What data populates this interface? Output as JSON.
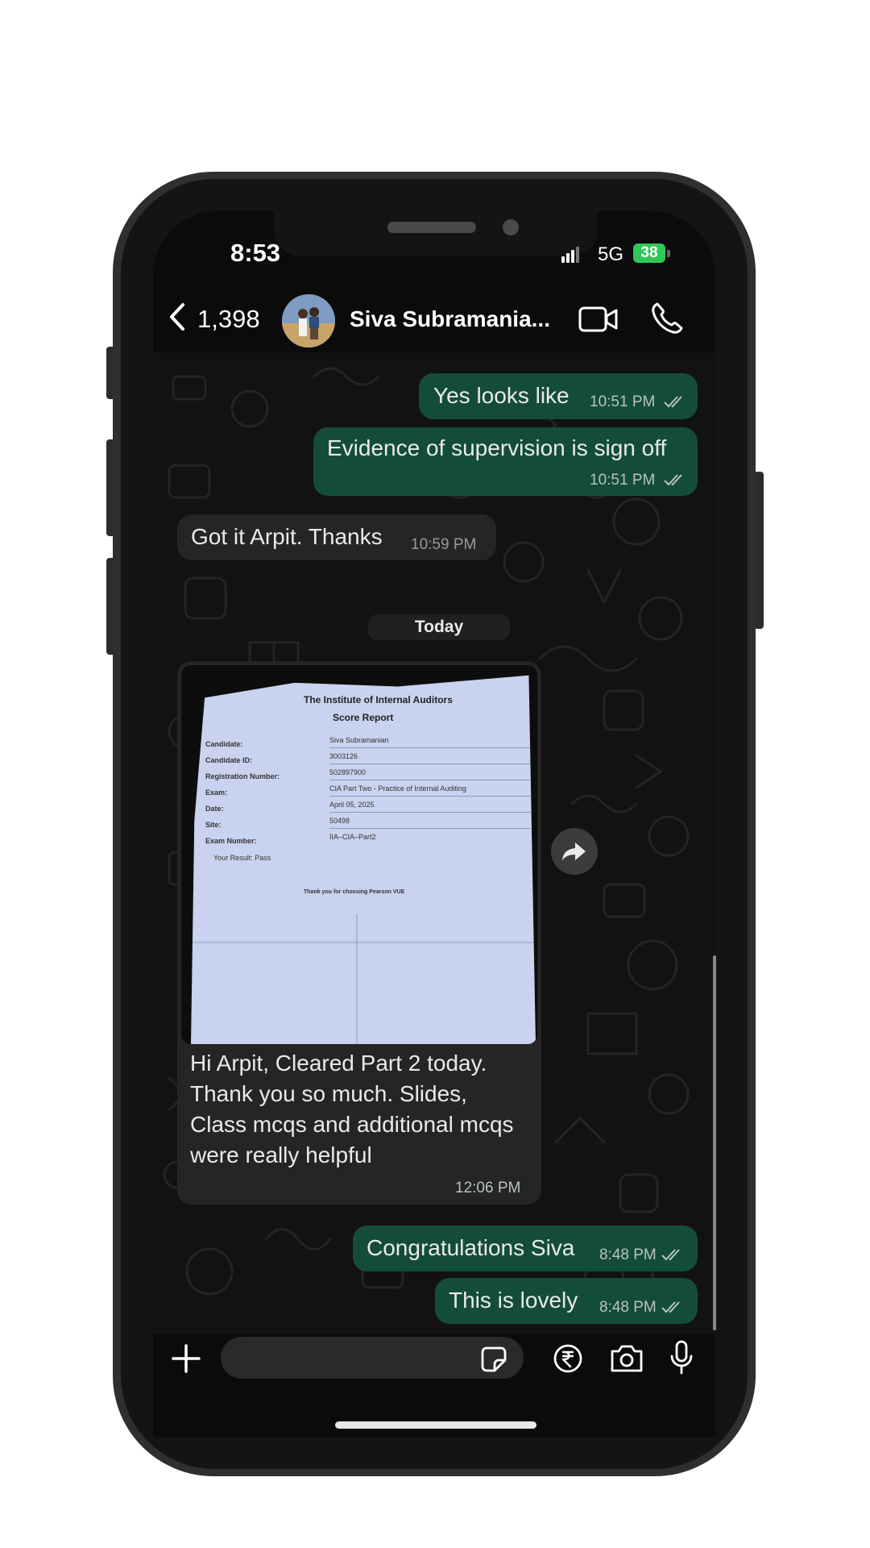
{
  "status_bar": {
    "time": "8:53",
    "network": "5G",
    "battery": "38"
  },
  "header": {
    "back_count": "1,398",
    "contact_name": "Siva Subramania...",
    "icons": [
      "back-chevron-icon",
      "video-call-icon",
      "voice-call-icon"
    ]
  },
  "messages": [
    {
      "text": "Yes looks like",
      "time": "10:51 PM",
      "direction": "out"
    },
    {
      "text": "Evidence of supervision is sign off",
      "time": "10:51 PM",
      "direction": "out"
    },
    {
      "text": "Got it Arpit. Thanks",
      "time": "10:59 PM",
      "direction": "in"
    },
    {
      "text": "Hi Arpit, Cleared Part 2 today. Thank you so much. Slides, Class mcqs and additional mcqs were really helpful",
      "time": "12:06 PM",
      "direction": "in",
      "has_photo": true
    },
    {
      "text": "Congratulations Siva",
      "time": "8:48 PM",
      "direction": "out"
    },
    {
      "text": "This is lovely",
      "time": "8:48 PM",
      "direction": "out"
    }
  ],
  "date_separator": "Today",
  "photo_document": {
    "title": "The Institute of Internal Auditors",
    "subtitle": "Score Report",
    "fields": [
      {
        "label": "Candidate:",
        "value": "Siva Subramanian"
      },
      {
        "label": "Candidate ID:",
        "value": "3003126"
      },
      {
        "label": "Registration Number:",
        "value": "502897900"
      },
      {
        "label": "Exam:",
        "value": "CIA Part Two - Practice of Internal Auditing"
      },
      {
        "label": "Date:",
        "value": "April 05, 2025"
      },
      {
        "label": "Site:",
        "value": "50498"
      },
      {
        "label": "Exam Number:",
        "value": "IIA–CIA–Part2"
      }
    ],
    "result": "Your Result: Pass",
    "footer": "Thank you for choosing Pearson VUE"
  },
  "input_bar": {
    "placeholder": "",
    "icons": [
      "plus-icon",
      "sticker-icon",
      "rupee-icon",
      "camera-icon",
      "microphone-icon"
    ]
  },
  "colors": {
    "outgoing_bubble": "#144d37",
    "incoming_bubble": "#252525",
    "battery": "#30c759"
  }
}
